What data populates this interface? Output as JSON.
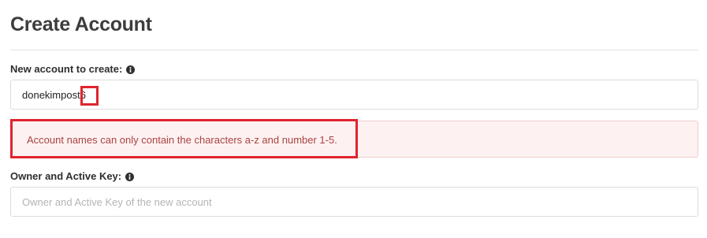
{
  "page": {
    "title": "Create Account"
  },
  "account_field": {
    "label": "New account to create:",
    "value": "donekimpost6",
    "icon": "info-circle-icon"
  },
  "error": {
    "message": "Account names can only contain the characters a-z and number 1-5."
  },
  "key_field": {
    "label": "Owner and Active Key:",
    "placeholder": "Owner and Active Key of the new account",
    "icon": "info-circle-icon"
  },
  "colors": {
    "highlight": "#e0242e",
    "error_text": "#a94442",
    "error_background": "#fdf1f1"
  }
}
